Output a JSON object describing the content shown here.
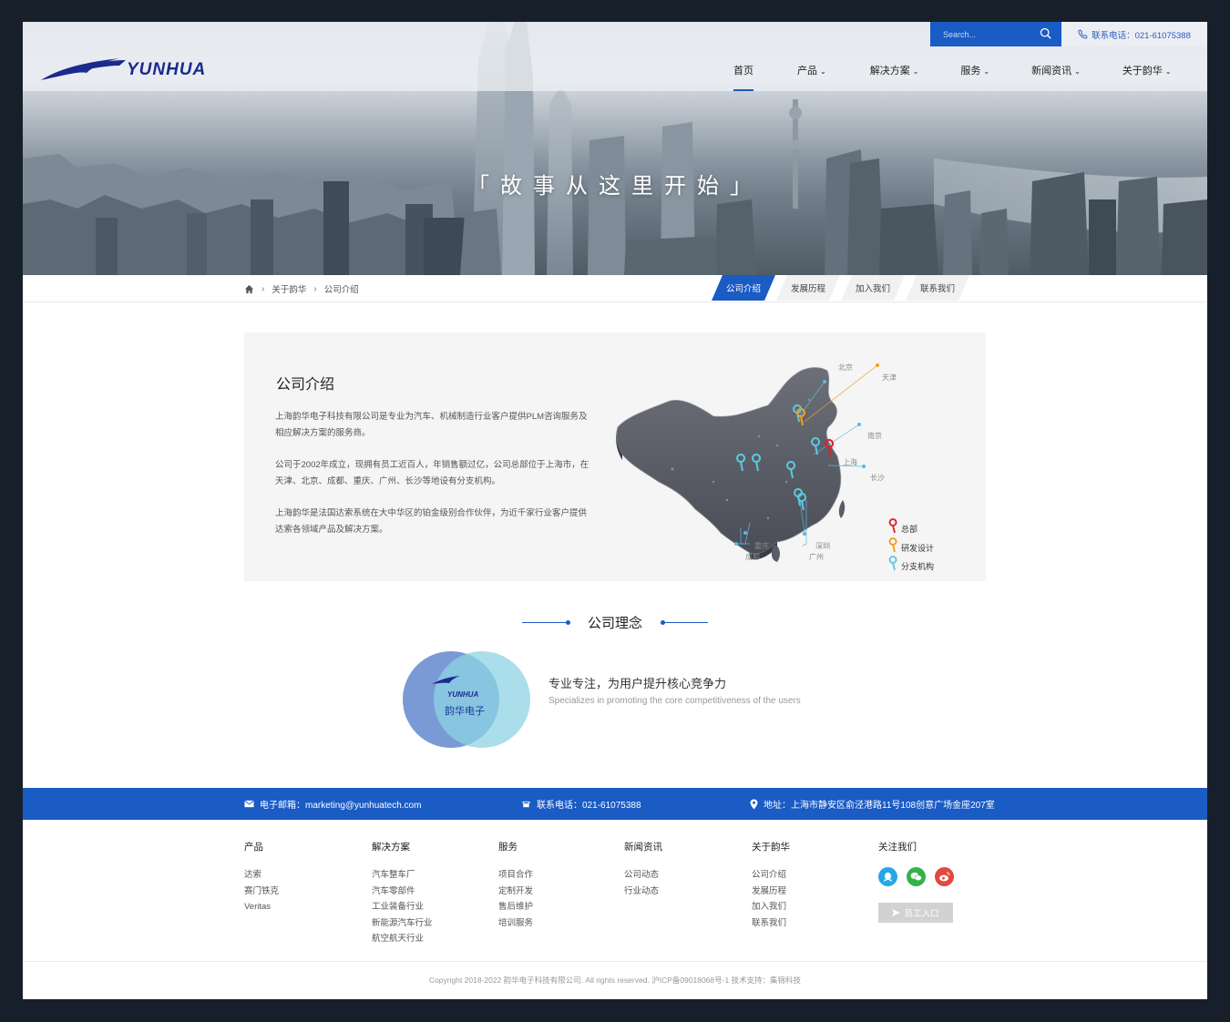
{
  "header": {
    "search_placeholder": "Search...",
    "phone": "联系电话：021-61075388",
    "logo_text": "YUNHUA",
    "nav": [
      {
        "label": "首页",
        "active": true,
        "dropdown": false
      },
      {
        "label": "产品",
        "active": false,
        "dropdown": true
      },
      {
        "label": "解决方案",
        "active": false,
        "dropdown": true
      },
      {
        "label": "服务",
        "active": false,
        "dropdown": true
      },
      {
        "label": "新闻资讯",
        "active": false,
        "dropdown": true
      },
      {
        "label": "关于韵华",
        "active": false,
        "dropdown": true
      }
    ]
  },
  "hero": {
    "slogan": "「故事从这里开始」"
  },
  "breadcrumb": {
    "items": [
      "关于韵华",
      "公司介绍"
    ]
  },
  "subtabs": [
    {
      "label": "公司介绍",
      "active": true
    },
    {
      "label": "发展历程",
      "active": false
    },
    {
      "label": "加入我们",
      "active": false
    },
    {
      "label": "联系我们",
      "active": false
    }
  ],
  "intro": {
    "title": "公司介绍",
    "paragraphs": [
      " 上海韵华电子科技有限公司是专业为汽车、机械制造行业客户提供PLM咨询服务及相应解决方案的服务商。",
      "公司于2002年成立，现拥有员工近百人，年销售额过亿，公司总部位于上海市，在天津、北京、成都、重庆、广州、长沙等地设有分支机构。",
      "上海韵华是法国达索系统在大中华区的铂金级别合作伙伴，为近千家行业客户提供达索各领域产品及解决方案。"
    ]
  },
  "map": {
    "cities": [
      "北京",
      "天津",
      "南京",
      "上海",
      "长沙",
      "深圳",
      "广州",
      "重庆",
      "成都"
    ],
    "legend": [
      {
        "label": "总部",
        "color": "#e0202a"
      },
      {
        "label": "研发设计",
        "color": "#f0a020"
      },
      {
        "label": "分支机构",
        "color": "#5cc8e0"
      }
    ]
  },
  "philosophy": {
    "title": "公司理念",
    "venn_label": "韵华电子",
    "venn_logo": "YUNHUA",
    "headline": "专业专注，为用户提升核心竞争力",
    "subline": "Specializes in promoting the core competitiveness of the users"
  },
  "contact": {
    "email": "电子邮箱：marketing@yunhuatech.com",
    "phone": "联系电话：021-61075388",
    "address": "地址：上海市静安区俞泾港路11号108创意广场金座207室"
  },
  "footer": {
    "columns": [
      {
        "title": "产品",
        "items": [
          "达索",
          "赛门铁克",
          "Veritas"
        ]
      },
      {
        "title": "解决方案",
        "items": [
          "汽车整车厂",
          "汽车零部件",
          "工业装备行业",
          "新能源汽车行业",
          "航空航天行业"
        ]
      },
      {
        "title": "服务",
        "items": [
          "项目合作",
          "定制开发",
          "售后维护",
          "培训服务"
        ]
      },
      {
        "title": "新闻资讯",
        "items": [
          "公司动态",
          "行业动态"
        ]
      },
      {
        "title": "关于韵华",
        "items": [
          "公司介绍",
          "发展历程",
          "加入我们",
          "联系我们"
        ]
      }
    ],
    "follow_title": "关注我们",
    "social": [
      "qq-icon",
      "wechat-icon",
      "weibo-icon"
    ],
    "staff_button": "员工入口",
    "copyright": "Copyright 2018-2022 韵华电子科技有限公司. All rights reserved. 沪ICP备09018068号-1    技术支持：集锦科技"
  },
  "colors": {
    "brand": "#1a5bc4",
    "footer_bar": "#1a5bc4",
    "panel_bg": "#f5f5f5"
  }
}
